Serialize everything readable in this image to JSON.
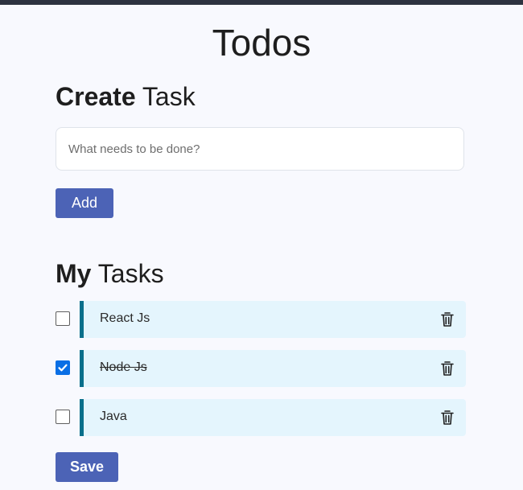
{
  "app": {
    "title": "Todos"
  },
  "create": {
    "heading_strong": "Create",
    "heading_light": "Task",
    "input_placeholder": "What needs to be done?",
    "add_label": "Add"
  },
  "tasks": {
    "heading_strong": "My",
    "heading_light": "Tasks",
    "items": [
      {
        "label": "React Js",
        "checked": false
      },
      {
        "label": "Node Js",
        "checked": true
      },
      {
        "label": "Java",
        "checked": false
      }
    ],
    "save_label": "Save"
  },
  "icons": {
    "delete": "trash-icon",
    "checkmark": "check-icon"
  },
  "colors": {
    "accent": "#4c63b6",
    "card_bg": "#e4f5fd",
    "card_border": "#096f8b",
    "checkbox_checked": "#0a6fe5"
  }
}
